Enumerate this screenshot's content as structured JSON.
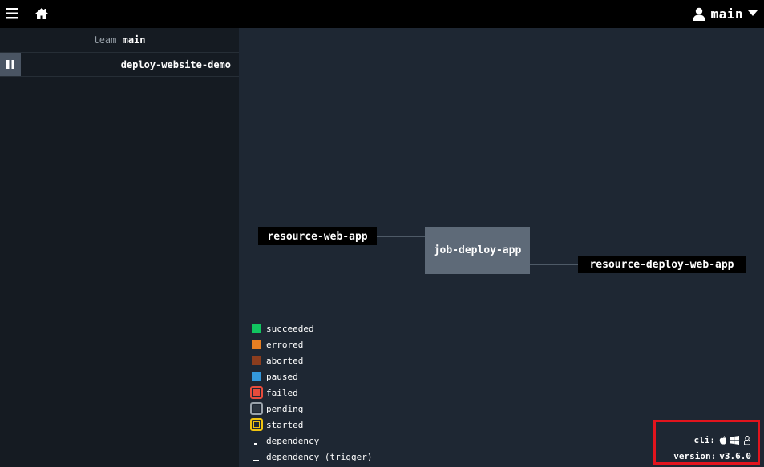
{
  "topbar": {
    "menu_icon": "hamburger-menu-icon",
    "home_icon": "home-icon",
    "user_icon": "user-icon",
    "user_name": "main",
    "dropdown_icon": "caret-down-icon"
  },
  "sidebar": {
    "team_label": "team",
    "team_name": "main",
    "pipelines": [
      {
        "name": "deploy-website-demo",
        "paused": true,
        "pause_icon": "pause-icon"
      }
    ]
  },
  "graph": {
    "inputs": [
      {
        "name": "resource-web-app"
      }
    ],
    "job": {
      "name": "job-deploy-app"
    },
    "outputs": [
      {
        "name": "resource-deploy-web-app"
      }
    ]
  },
  "legend": [
    {
      "label": "succeeded",
      "color": "#11c560",
      "style": "solid"
    },
    {
      "label": "errored",
      "color": "#e67e22",
      "style": "solid"
    },
    {
      "label": "aborted",
      "color": "#8b3d1e",
      "style": "solid"
    },
    {
      "label": "paused",
      "color": "#3498db",
      "style": "solid"
    },
    {
      "label": "failed",
      "color": "#e74c3c",
      "border": "#e74c3c",
      "style": "outlined"
    },
    {
      "label": "pending",
      "color": "#2c3540",
      "border": "#9aa3ab",
      "style": "outlined"
    },
    {
      "label": "started",
      "color": "#1e2733",
      "border": "#f1c40f",
      "style": "outlined"
    },
    {
      "label": "dependency",
      "style": "dependency"
    },
    {
      "label": "dependency (trigger)",
      "style": "dependency-trigger"
    }
  ],
  "footer": {
    "cli_label": "cli:",
    "cli_icons": [
      "apple-icon",
      "windows-icon",
      "linux-icon"
    ],
    "version_label": "version:",
    "version_value": "v3.6.0",
    "highlight_color": "#e2141d"
  }
}
